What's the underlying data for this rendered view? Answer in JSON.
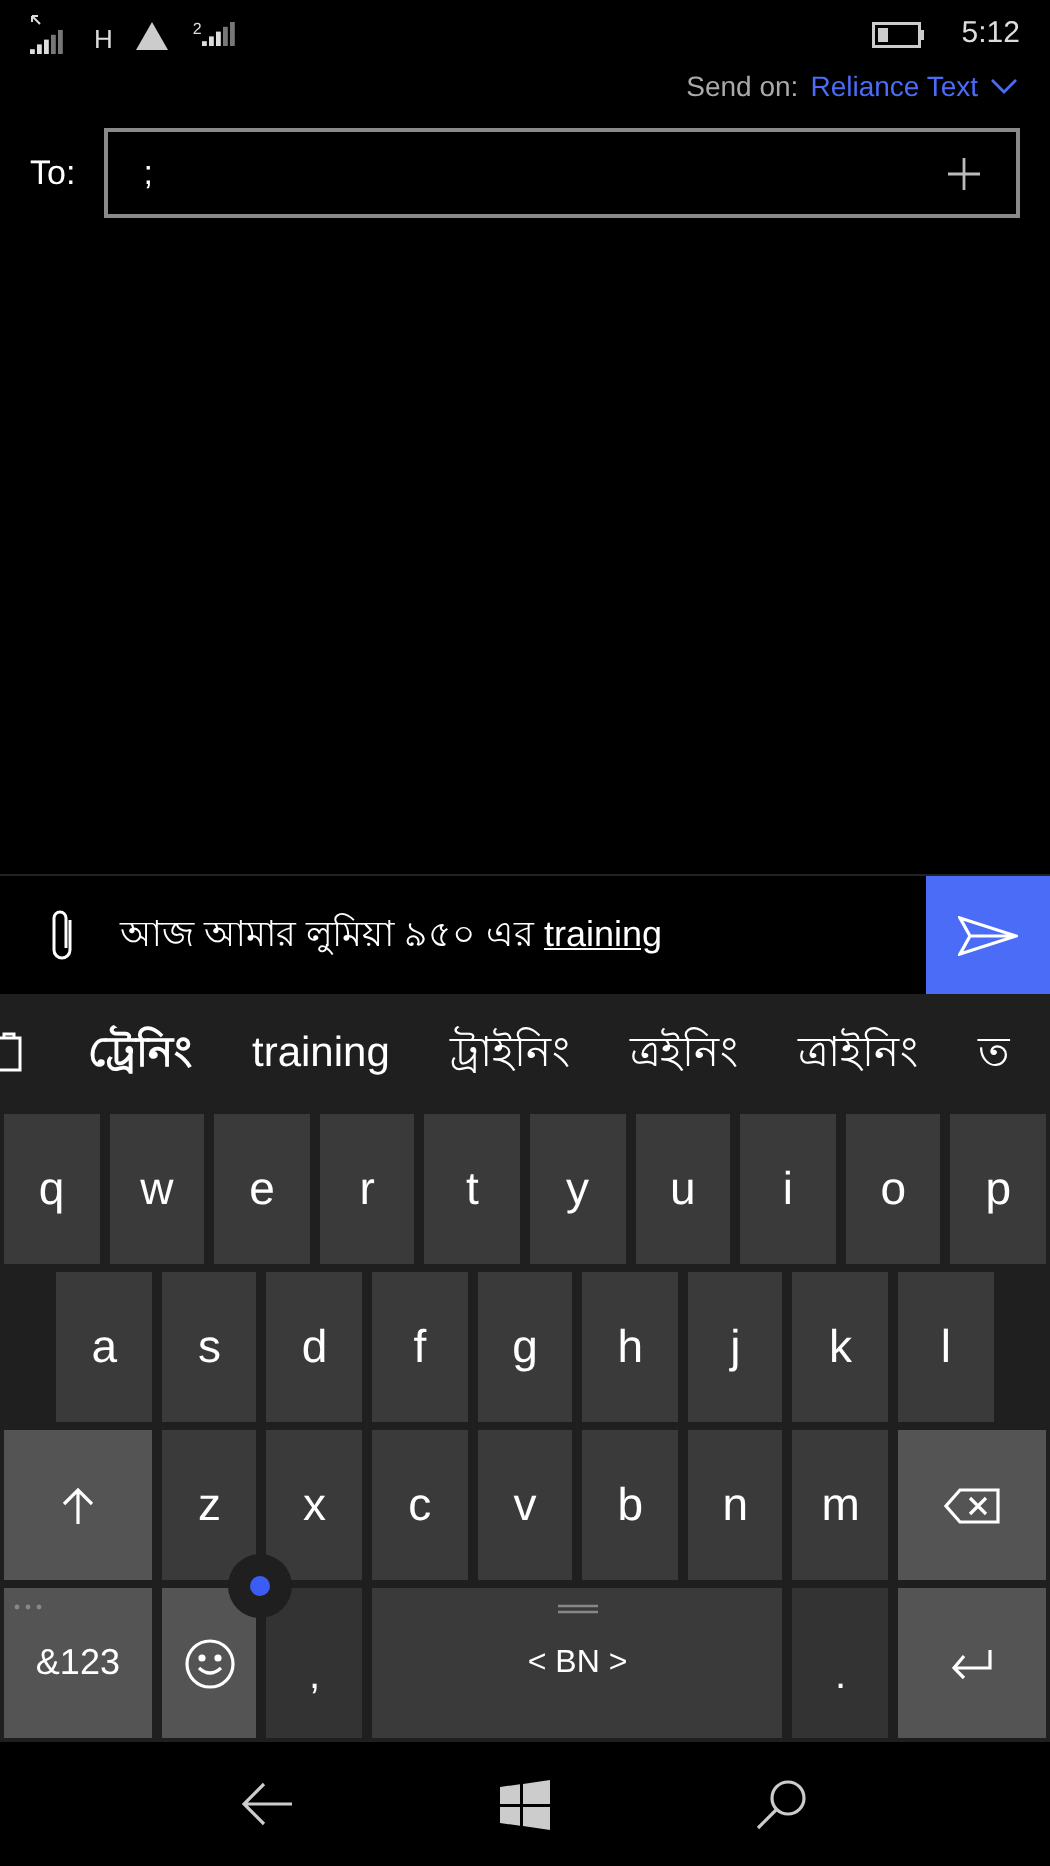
{
  "status_bar": {
    "network_type": "H",
    "sim_label": "2",
    "time": "5:12"
  },
  "send_on": {
    "label": "Send on:",
    "value": "Reliance Text"
  },
  "to": {
    "label": "To:",
    "value": ";"
  },
  "message": {
    "value": "আজ আমার লুমিয়া ৯৫০ এর ",
    "composing": "training"
  },
  "suggestions": [
    {
      "text": "ট্রেনিং",
      "selected": true
    },
    {
      "text": "training",
      "selected": false
    },
    {
      "text": "ট্রাইনিং",
      "selected": false
    },
    {
      "text": "ত্রইনিং",
      "selected": false
    },
    {
      "text": "ত্রাইনিং",
      "selected": false
    },
    {
      "text": "ত",
      "selected": false
    }
  ],
  "keyboard": {
    "key_rows": [
      {
        "keys": [
          {
            "kind": "letter",
            "label": "q"
          },
          {
            "kind": "letter",
            "label": "w"
          },
          {
            "kind": "letter",
            "label": "e"
          },
          {
            "kind": "letter",
            "label": "r"
          },
          {
            "kind": "letter",
            "label": "t"
          },
          {
            "kind": "letter",
            "label": "y"
          },
          {
            "kind": "letter",
            "label": "u"
          },
          {
            "kind": "letter",
            "label": "i"
          },
          {
            "kind": "letter",
            "label": "o"
          },
          {
            "kind": "letter",
            "label": "p"
          }
        ]
      },
      {
        "keys": [
          {
            "kind": "letter",
            "label": "a"
          },
          {
            "kind": "letter",
            "label": "s"
          },
          {
            "kind": "letter",
            "label": "d"
          },
          {
            "kind": "letter",
            "label": "f"
          },
          {
            "kind": "letter",
            "label": "g"
          },
          {
            "kind": "letter",
            "label": "h"
          },
          {
            "kind": "letter",
            "label": "j"
          },
          {
            "kind": "letter",
            "label": "k"
          },
          {
            "kind": "letter",
            "label": "l"
          }
        ]
      },
      {
        "keys": [
          {
            "kind": "shift"
          },
          {
            "kind": "letter",
            "label": "z"
          },
          {
            "kind": "letter",
            "label": "x"
          },
          {
            "kind": "letter",
            "label": "c"
          },
          {
            "kind": "letter",
            "label": "v"
          },
          {
            "kind": "letter",
            "label": "b"
          },
          {
            "kind": "letter",
            "label": "n"
          },
          {
            "kind": "letter",
            "label": "m"
          },
          {
            "kind": "backspace"
          }
        ]
      },
      {
        "keys": [
          {
            "kind": "symbols",
            "label": "&123"
          },
          {
            "kind": "emoji"
          },
          {
            "kind": "punct",
            "label": ","
          },
          {
            "kind": "space",
            "label": "< BN >"
          },
          {
            "kind": "punct",
            "label": "."
          },
          {
            "kind": "enter"
          }
        ]
      }
    ]
  }
}
